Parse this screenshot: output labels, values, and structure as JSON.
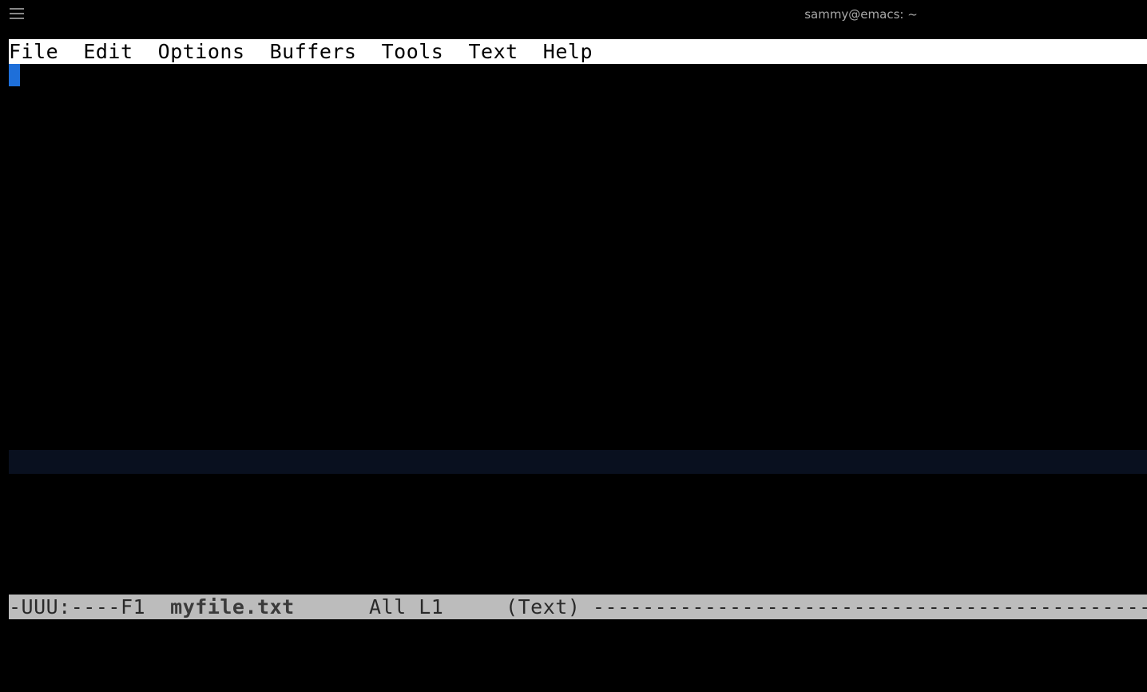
{
  "titlebar": {
    "title": "sammy@emacs: ~"
  },
  "menu": {
    "items": [
      "File",
      "Edit",
      "Options",
      "Buffers",
      "Tools",
      "Text",
      "Help"
    ]
  },
  "modeline": {
    "prefix": "-UUU:----F1  ",
    "buffer_name": "myfile.txt",
    "mid": "      All L1     (Text) ",
    "dashes": "----------------------------------------------------------------------------"
  }
}
